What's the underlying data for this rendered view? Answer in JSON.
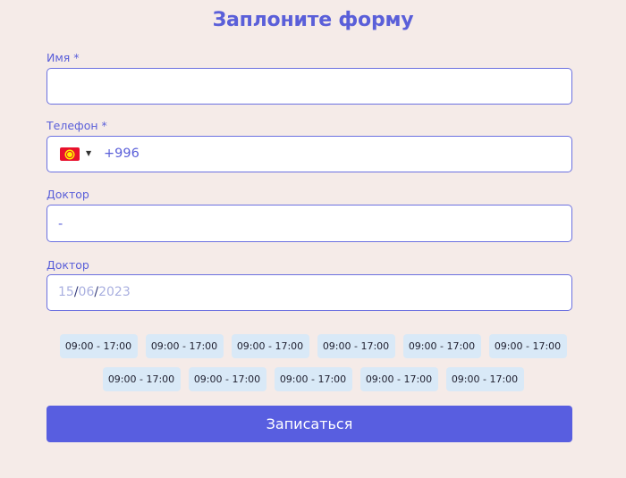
{
  "form": {
    "title": "Заплоните форму",
    "name_label": "Имя *",
    "name_value": "",
    "phone_label": "Телефон *",
    "phone_country_flag": "kyrgyzstan-flag-icon",
    "phone_value": "+996",
    "doctor_label": "Доктор",
    "doctor_value": "-",
    "date_label": "Доктор",
    "date": {
      "day": "15",
      "month": "06",
      "year": "2023",
      "separator": "/"
    },
    "time_slots_row1": [
      "09:00 - 17:00",
      "09:00 - 17:00",
      "09:00 - 17:00",
      "09:00 - 17:00",
      "09:00 - 17:00",
      "09:00 - 17:00"
    ],
    "time_slots_row2": [
      "09:00 - 17:00",
      "09:00 - 17:00",
      "09:00 - 17:00",
      "09:00 - 17:00",
      "09:00 - 17:00"
    ],
    "submit_label": "Записаться"
  },
  "colors": {
    "background": "#f5ebe8",
    "accent": "#585ee0",
    "slot_background": "#d9e9f7"
  }
}
